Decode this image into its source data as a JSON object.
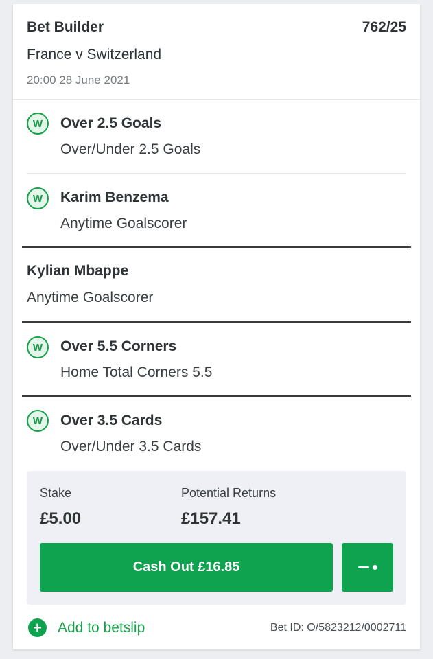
{
  "bet": {
    "type": "Bet Builder",
    "odds": "762/25",
    "event": "France v Switzerland",
    "datetime": "20:00 28 June 2021"
  },
  "selections": [
    {
      "title": "Over 2.5 Goals",
      "market": "Over/Under 2.5 Goals",
      "result_badge": "W"
    },
    {
      "title": "Karim Benzema",
      "market": "Anytime Goalscorer",
      "result_badge": "W"
    },
    {
      "title": "Kylian Mbappe",
      "market": "Anytime Goalscorer",
      "result_badge": ""
    },
    {
      "title": "Over 5.5 Corners",
      "market": "Home Total Corners 5.5",
      "result_badge": "W"
    },
    {
      "title": "Over 3.5 Cards",
      "market": "Over/Under 3.5 Cards",
      "result_badge": "W"
    }
  ],
  "stake": {
    "label": "Stake",
    "value": "£5.00"
  },
  "returns": {
    "label": "Potential Returns",
    "value": "£157.41"
  },
  "cashout": {
    "label": "Cash Out £16.85"
  },
  "partial_cashout": {
    "icon": "slider-icon"
  },
  "footer": {
    "add_icon": "plus-circle-icon",
    "add_label": "Add to betslip",
    "bet_id": "Bet ID: O/5823212/0002711"
  },
  "colors": {
    "accent_green": "#0ea34f",
    "win_badge_bg": "#e3f6e9",
    "stake_panel_bg": "#eef0f6"
  }
}
